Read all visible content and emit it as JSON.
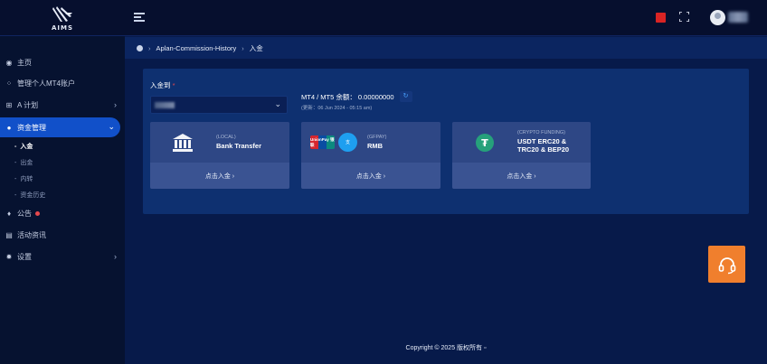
{
  "app": {
    "logo_text": "AIMS"
  },
  "header": {
    "flag": "cn-flag-icon"
  },
  "sidebar": {
    "items": [
      {
        "label": "主页",
        "icon": "home-icon"
      },
      {
        "label": "管理个人MT4账户",
        "icon": "grid-icon"
      },
      {
        "label": "A 计划",
        "icon": "org-icon"
      },
      {
        "label": "资金管理",
        "icon": "dollar-icon"
      },
      {
        "label": "公告",
        "icon": "bell-icon"
      },
      {
        "label": "活动资讯",
        "icon": "doc-icon"
      },
      {
        "label": "设置",
        "icon": "gear-icon"
      }
    ],
    "sub_items": [
      "入金",
      "出金",
      "内转",
      "资金历史"
    ]
  },
  "breadcrumb": {
    "items": [
      "Aplan-Commission-History",
      "入金"
    ]
  },
  "deposit": {
    "field_label": "入金到",
    "required_mark": "*",
    "balance_text": "MT4 / MT5 余额： 0.00000000",
    "updated_text": "(更新：06 Jun 2024 - 05:15 am)"
  },
  "cards": [
    {
      "sub": "(LOCAL)",
      "title": "Bank Transfer",
      "action": "点击入金 ›"
    },
    {
      "sub": "(GFPAY)",
      "title": "RMB",
      "action": "点击入金 ›",
      "badge": "UnionPay 银联"
    },
    {
      "sub": "(CRYPTO FUNDING)",
      "title": "USDT ERC20 & TRC20 & BEP20",
      "action": "点击入金 ›"
    }
  ],
  "footer": {
    "text": "Copyright © 2025 版权所有 ▫"
  },
  "colors": {
    "accent": "#1150c9",
    "support": "#f07f2d",
    "tether": "#26a17b"
  }
}
